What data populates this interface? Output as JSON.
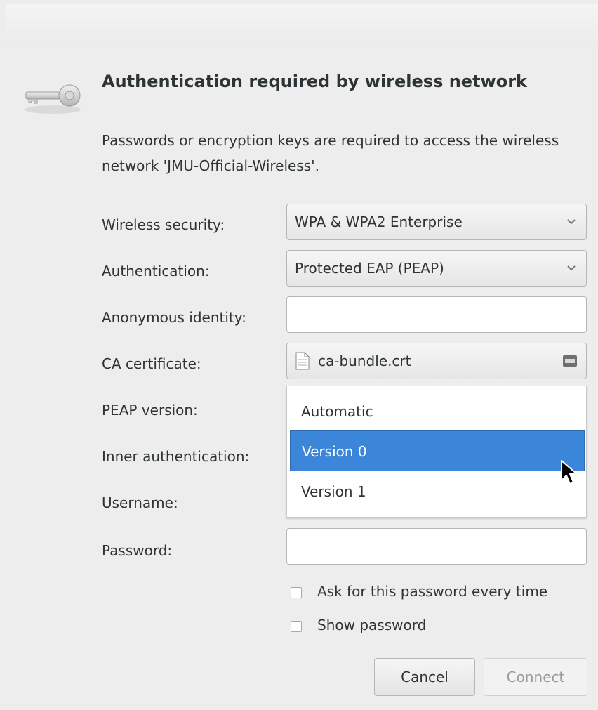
{
  "dialog": {
    "title": "Authentication required by wireless network",
    "description": "Passwords or encryption keys are required to access the wireless network 'JMU-Official-Wireless'."
  },
  "form": {
    "wireless_security": {
      "label": "Wireless security:",
      "value": "WPA & WPA2 Enterprise"
    },
    "authentication": {
      "label": "Authentication:",
      "value": "Protected EAP (PEAP)"
    },
    "anonymous_identity": {
      "label": "Anonymous identity:",
      "value": ""
    },
    "ca_certificate": {
      "label": "CA certificate:",
      "value": "ca-bundle.crt"
    },
    "peap_version": {
      "label": "PEAP version:"
    },
    "inner_authentication": {
      "label": "Inner authentication:"
    },
    "username": {
      "label": "Username:"
    },
    "password": {
      "label": "Password:",
      "value": ""
    }
  },
  "peap_dropdown": {
    "options": [
      "Automatic",
      "Version 0",
      "Version 1"
    ],
    "selected": "Version 0"
  },
  "checkboxes": {
    "ask_password": {
      "label": "Ask for this password every time",
      "checked": false
    },
    "show_password": {
      "label": "Show password",
      "checked": false
    }
  },
  "buttons": {
    "cancel": "Cancel",
    "connect": "Connect"
  },
  "icons": {
    "key": "key-icon",
    "file": "file-icon",
    "folder": "folder-icon",
    "chevron": "chevron-down-icon"
  },
  "colors": {
    "selection": "#3b86d8",
    "background": "#ededed"
  }
}
